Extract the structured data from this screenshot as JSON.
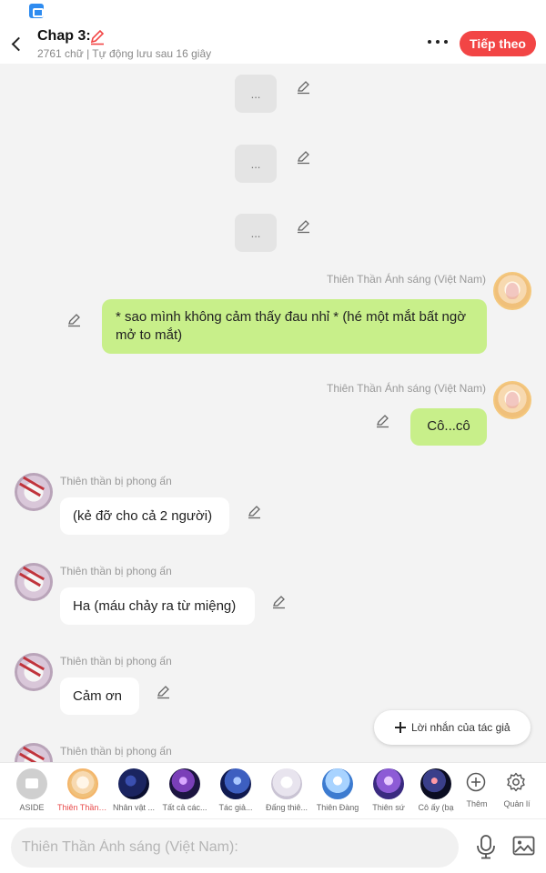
{
  "header": {
    "title": "Chap 3:",
    "word_count": "2761 chữ | Tự động lưu sau 16 giây",
    "follow_label": "Tiếp theo"
  },
  "chat": {
    "ellipsis_blocks": [
      "...",
      "...",
      "..."
    ],
    "messages": [
      {
        "side": "right",
        "sender": "Thiên Thần Ánh sáng (Việt Nam)",
        "text": "* sao mình không cảm thấy đau nhỉ * (hé một mắt bất ngờ mở to mắt)"
      },
      {
        "side": "right",
        "sender": "Thiên Thần Ánh sáng (Việt Nam)",
        "text": "Cô...cô"
      },
      {
        "side": "left",
        "sender": "Thiên thần bị phong ấn",
        "text": "(kẻ đỡ cho cả 2 người)"
      },
      {
        "side": "left",
        "sender": "Thiên thần bị phong ấn",
        "text": "Ha (máu chảy ra từ miệng)"
      },
      {
        "side": "left",
        "sender": "Thiên thần bị phong ấn",
        "text": "Cảm ơn"
      },
      {
        "side": "left",
        "sender": "Thiên thần bị phong ấn",
        "text": ""
      }
    ],
    "author_note_label": "Lời nhắn của tác giả"
  },
  "characters": [
    {
      "label": "ASIDE",
      "icon": "aside-icon"
    },
    {
      "label": "Thiên Thần Ánh sáng (Việt Nam)",
      "icon": "angel-avatar",
      "selected": true
    },
    {
      "label": "Nhân vật ...",
      "icon": "galaxy-avatar"
    },
    {
      "label": "Tất cả các...",
      "icon": "nebula-avatar"
    },
    {
      "label": "Tác giả...",
      "icon": "space-avatar"
    },
    {
      "label": "Đấng thiê...",
      "icon": "figure-avatar"
    },
    {
      "label": "Thiên Đàng",
      "icon": "heaven-avatar"
    },
    {
      "label": "Thiên sứ",
      "icon": "purple-sky-avatar"
    },
    {
      "label": "Cô ấy (bạ",
      "icon": "dark-galaxy-avatar"
    },
    {
      "label": "Thêm",
      "icon": "add-circle-icon"
    },
    {
      "label": "Quản lí",
      "icon": "settings-gear-icon"
    }
  ],
  "input": {
    "placeholder": "Thiên Thần Ánh sáng (Việt Nam):"
  },
  "colors": {
    "accent": "#f24545",
    "bubble_right": "#c8ef8a",
    "bubble_left": "#ffffff"
  }
}
